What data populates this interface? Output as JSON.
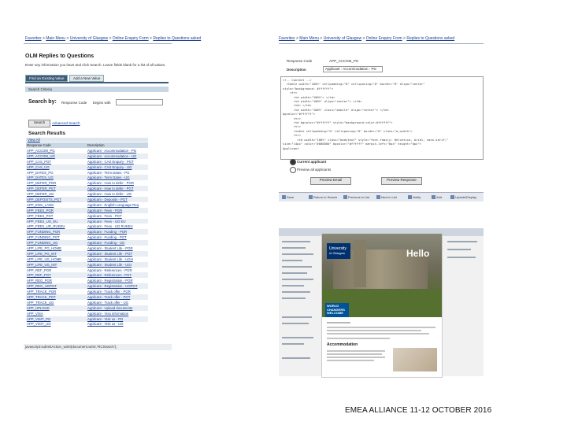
{
  "left": {
    "breadcrumb": [
      "Favorites",
      "Main Menu",
      "University of Glasgow",
      "Online Enquiry Form",
      "Replies to Questions asked"
    ],
    "title": "OLM Replies to Questions",
    "instructions": "Enter any information you have and click Search. Leave fields blank for a list of all values.",
    "tabs": [
      "Find an Existing Value",
      "Add a New Value"
    ],
    "search_criteria_label": "Search Criteria",
    "search_by_label": "Search by:",
    "search_field": "Response Code",
    "operator": "begins with",
    "search_button": "Search",
    "advanced_search": "Advanced Search",
    "results_title": "Search Results",
    "view_all": "View All",
    "columns": [
      "Response Code",
      "Description"
    ],
    "rows": [
      [
        "APP_ACCOM_PG",
        "Applicant - Accommodation - PG"
      ],
      [
        "APP_ACCOM_UG",
        "Applicant - Accommodation - UG"
      ],
      [
        "APP_CAS_PGT",
        "Applicant - CAS Enquiry - PGT"
      ],
      [
        "APP_CAS_UG",
        "Applicant - CAS Enquiry - UG"
      ],
      [
        "APP_DATES_PG",
        "Applicant - Term Dates - PG"
      ],
      [
        "APP_DATES_UG",
        "Applicant - Term Dates - UG"
      ],
      [
        "APP_DEFER_PGR",
        "Applicant - How to defer - PGR"
      ],
      [
        "APP_DEFER_PGT",
        "Applicant - How to defer - PGT"
      ],
      [
        "APP_DEFER_UG",
        "Applicant - How to defer - UG"
      ],
      [
        "APP_DEPOSITS_PGT",
        "Applicant - Deposits - PGT"
      ],
      [
        "APP_ENG_LANG",
        "Applicant - English Language Req"
      ],
      [
        "APP_FEES_PGR",
        "Applicant - Fees - PGR"
      ],
      [
        "APP_FEES_PGT",
        "Applicant - Fees - PGT"
      ],
      [
        "APP_FEES_UG_EU",
        "Applicant - Fees - UG EU"
      ],
      [
        "APP_FEES_UG_RUKEU",
        "Applicant - Fees - UG RUKEU"
      ],
      [
        "APP_FUNDING_PGR",
        "Applicant - Funding - PGR"
      ],
      [
        "APP_FUNDING_PGT",
        "Applicant - Funding - PGT"
      ],
      [
        "APP_FUNDING_UG",
        "Applicant - Funding - UG"
      ],
      [
        "APP_LIFE_PG_HOME",
        "Applicant - Student Life - PGR"
      ],
      [
        "APP_LIFE_PG_INT",
        "Applicant - Student Life - PGT"
      ],
      [
        "APP_LIFE_UG_HOME",
        "Applicant - Student Life - UGH"
      ],
      [
        "APP_LIFE_UG_INT",
        "Applicant - Student Life - UGI"
      ],
      [
        "APP_REF_PGR",
        "Applicant - References - PGR"
      ],
      [
        "APP_REF_PGT",
        "Applicant - References - PGT"
      ],
      [
        "APP_REG_PGR",
        "Applicant - Registration - PGR"
      ],
      [
        "APP_REG_UGPGT",
        "Applicant - Registration - UGPGT"
      ],
      [
        "APP_TRACK_PGR",
        "Applicant - Track offer - PGR"
      ],
      [
        "APP_TRACK_PGT",
        "Applicant - Track offer - PGT"
      ],
      [
        "APP_TRACK_UG",
        "Applicant - Track offer - UG"
      ],
      [
        "APP_UPLOAD",
        "Applicant - Upload documents"
      ],
      [
        "APP_VISA",
        "Applicant - Visa information"
      ],
      [
        "APP_VISIT_PG",
        "Applicant - Visit us - PG"
      ],
      [
        "APP_VISIT_UG",
        "Applicant - Visit us - UG"
      ]
    ],
    "status_url": "javascript:submitAction_win0(document.win0,'#ICSearch');"
  },
  "right_top": {
    "breadcrumb": [
      "Favorites",
      "Main Menu",
      "University of Glasgow",
      "Online Enquiry Form",
      "Replies to Questions asked"
    ],
    "response_code_label": "Response Code",
    "response_code_value": "APP_ACCOM_PG",
    "description_label": "Description",
    "description_value": "Applicant - Accommodation - PG",
    "html_lines": [
      "<!-- Content -->",
      "  <table width=\"100%\" cellpadding=\"0\" cellspacing=\"0\" border=\"0\" align=\"center\"",
      "style=\"background: #ffffff\">",
      "    <tr>",
      "      <td width=\"100%\"> </td>",
      "      <td width=\"100%\" align=\"center\"> </td>",
      "      <td> </td>",
      "      <td width=\"100%\" class=\"mobile\" align=\"center\"> </td>",
      "bgcolor=\"#ffffff\">",
      "      <tr>",
      "      <td bgcolor=\"#ffffff\" style=\"background-color:#ffffff\">",
      "      <tr>",
      "",
      "      <table cellpadding=\"0\" cellspacing=\"0\" border=\"0\" class=\"m_width\">",
      "      <tr>",
      "        <td width=\"100%\" class=\"bodytext\" style=\"font-family: Helvetica, Arial; sans-serif;\"",
      "size=\"14px\" color=\"#000000\" bgcolor=\"#ffffff\" margin-left=\"0px\" height=\"0px\">",
      "Applicant"
    ],
    "radio_current": "Current applicant",
    "radio_preview": "Preview all applicants",
    "preview_email": "Preview Email",
    "preview_response": "Preview Response",
    "toolbar": [
      "Save",
      "Return to Search",
      "Previous in List",
      "Next in List",
      "Notify",
      "Add",
      "Update/Display"
    ]
  },
  "right_bottom": {
    "hello": "Hello",
    "brand_line1": "University",
    "brand_line2": "of Glasgow",
    "world_changers": "WORLD CHANGERS WELCOME",
    "accommodation": "Accommodation"
  },
  "footer": "EMEA ALLIANCE   11-12 OCTOBER 2016"
}
